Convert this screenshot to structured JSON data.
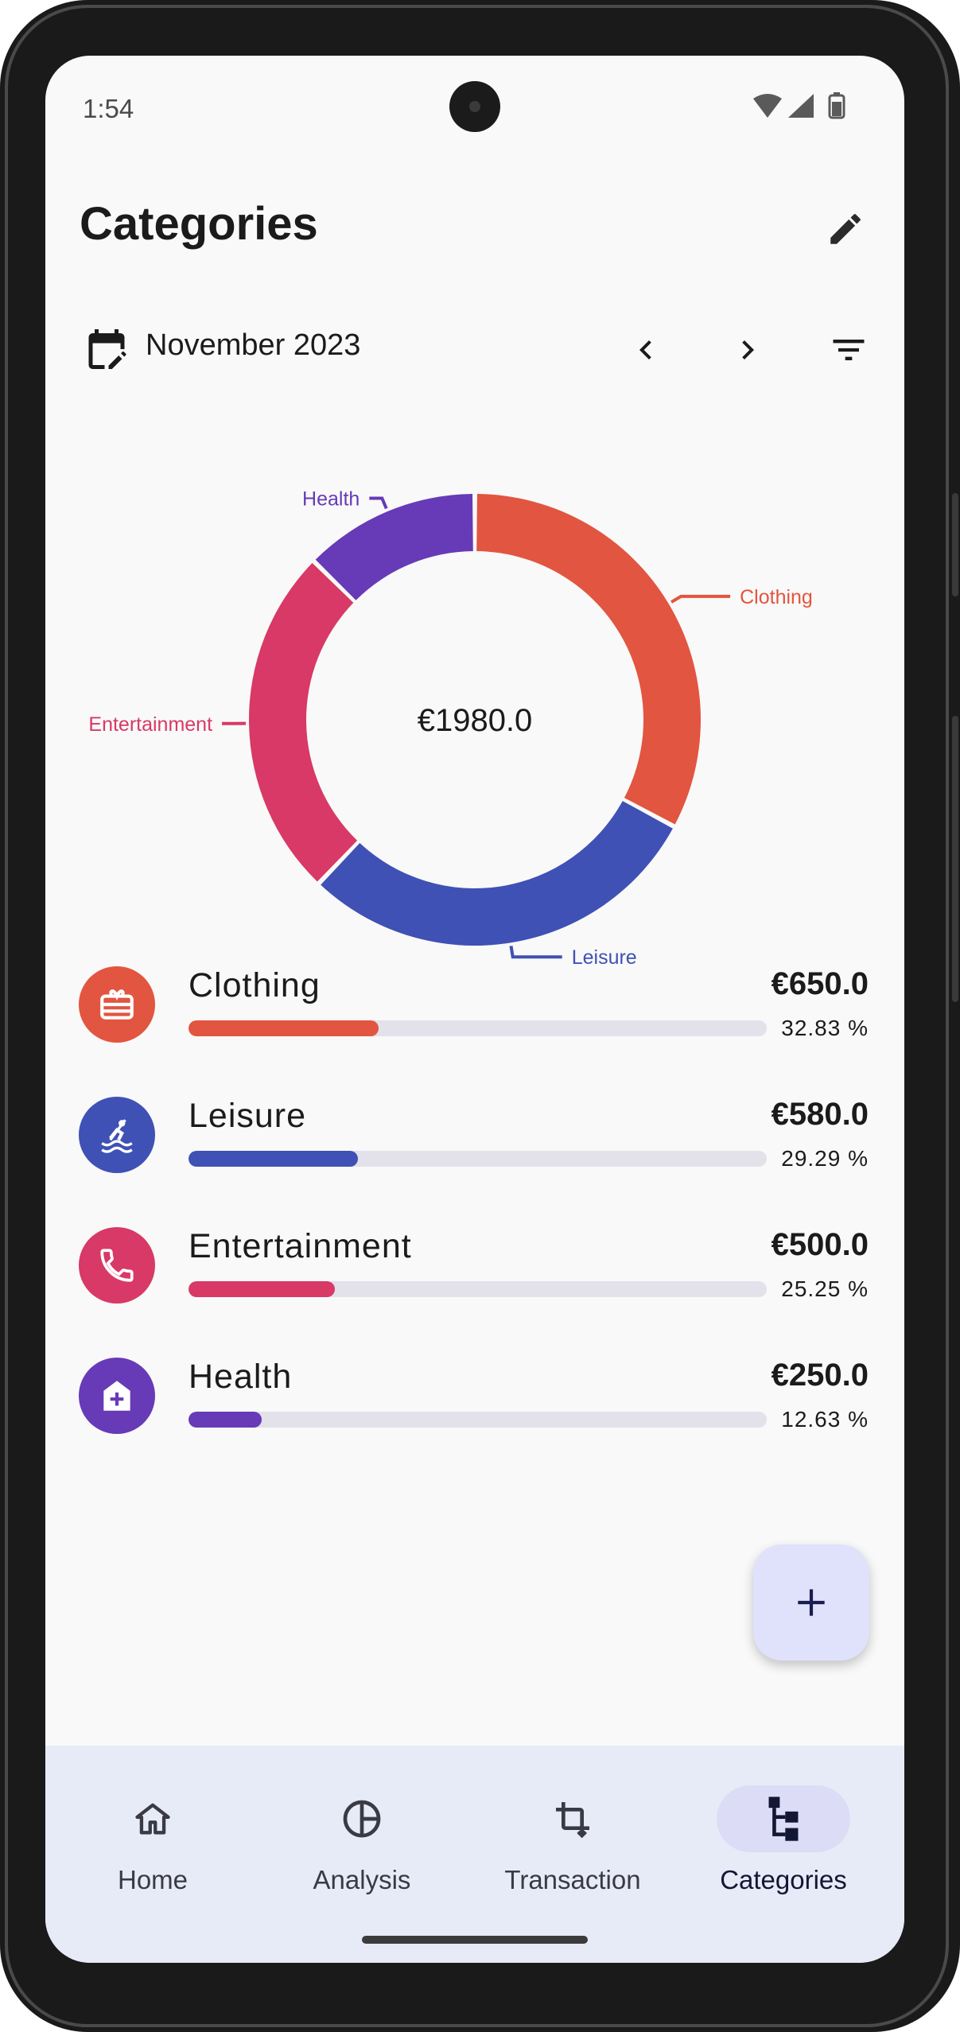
{
  "status_bar": {
    "time": "1:54"
  },
  "header": {
    "title": "Categories",
    "edit_icon": "pencil-icon"
  },
  "period": {
    "label": "November 2023",
    "calendar_icon": "calendar-edit-icon"
  },
  "colors": {
    "clothing": "#e25540",
    "leisure": "#3f51b5",
    "entertainment": "#d83966",
    "health": "#673ab7",
    "accent": "#dcdcf6"
  },
  "chart_data": {
    "type": "pie",
    "center_label": "€1980.0",
    "slices": [
      {
        "label": "Clothing",
        "value": 650.0,
        "percent": 32.83,
        "color": "#e25540"
      },
      {
        "label": "Leisure",
        "value": 580.0,
        "percent": 29.29,
        "color": "#3f51b5"
      },
      {
        "label": "Entertainment",
        "value": 500.0,
        "percent": 25.25,
        "color": "#d83966"
      },
      {
        "label": "Health",
        "value": 250.0,
        "percent": 12.63,
        "color": "#673ab7"
      }
    ]
  },
  "categories": [
    {
      "name": "Clothing",
      "amount": "€650.0",
      "percent": "32.83 %",
      "fraction": 0.3283,
      "color": "#e25540",
      "icon": "gift-card-icon"
    },
    {
      "name": "Leisure",
      "amount": "€580.0",
      "percent": "29.29 %",
      "fraction": 0.2929,
      "color": "#3f51b5",
      "icon": "kayaking-icon"
    },
    {
      "name": "Entertainment",
      "amount": "€500.0",
      "percent": "25.25 %",
      "fraction": 0.2525,
      "color": "#d83966",
      "icon": "phone-icon"
    },
    {
      "name": "Health",
      "amount": "€250.0",
      "percent": "12.63 %",
      "fraction": 0.1263,
      "color": "#673ab7",
      "icon": "medical-house-icon"
    }
  ],
  "fab": {
    "icon": "plus-icon"
  },
  "nav": {
    "items": [
      {
        "label": "Home",
        "icon": "home-icon"
      },
      {
        "label": "Analysis",
        "icon": "pie-chart-icon"
      },
      {
        "label": "Transaction",
        "icon": "crop-rotate-icon"
      },
      {
        "label": "Categories",
        "icon": "category-tree-icon"
      }
    ],
    "active": "Categories"
  }
}
